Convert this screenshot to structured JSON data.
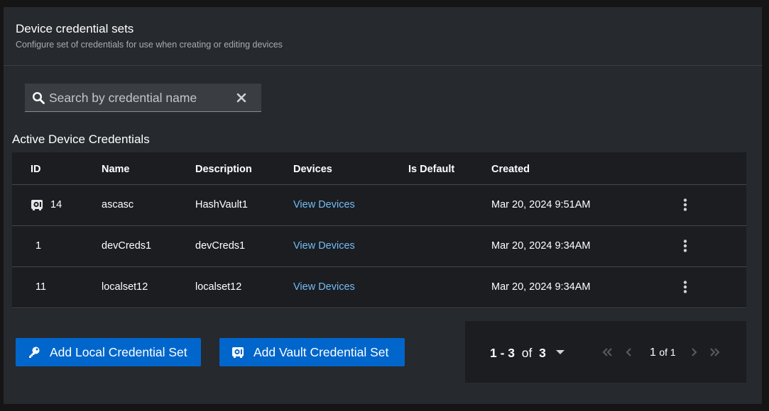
{
  "header": {
    "title": "Device credential sets",
    "subtitle": "Configure set of credentials for use when creating or editing devices"
  },
  "search": {
    "placeholder": "Search by credential name",
    "value": ""
  },
  "section_title": "Active Device Credentials",
  "table": {
    "columns": [
      "ID",
      "Name",
      "Description",
      "Devices",
      "Is Default",
      "Created"
    ],
    "rows": [
      {
        "id": "14",
        "name": "ascasc",
        "description": "HashVault1",
        "devices": "View Devices",
        "is_default": "",
        "created": "Mar 20, 2024 9:51AM",
        "icon": "vault-icon"
      },
      {
        "id": "1",
        "name": "devCreds1",
        "description": "devCreds1",
        "devices": "View Devices",
        "is_default": "",
        "created": "Mar 20, 2024 9:34AM",
        "icon": ""
      },
      {
        "id": "11",
        "name": "localset12",
        "description": "localset12",
        "devices": "View Devices",
        "is_default": "",
        "created": "Mar 20, 2024 9:34AM",
        "icon": ""
      }
    ]
  },
  "buttons": {
    "add_local": {
      "label": "Add Local Credential Set",
      "icon": "key-icon"
    },
    "add_vault": {
      "label": "Add Vault Credential Set",
      "icon": "vault-icon"
    }
  },
  "pagination": {
    "range_start": "1",
    "range_sep": " - ",
    "range_end": "3",
    "of_word": "of",
    "total": "3",
    "current_page": "1",
    "page_suffix": "of 1"
  },
  "colors": {
    "background": "#151515",
    "panel": "#26292d",
    "table": "#1b1d21",
    "primary_button": "#0066cc",
    "link": "#73bcf7"
  }
}
